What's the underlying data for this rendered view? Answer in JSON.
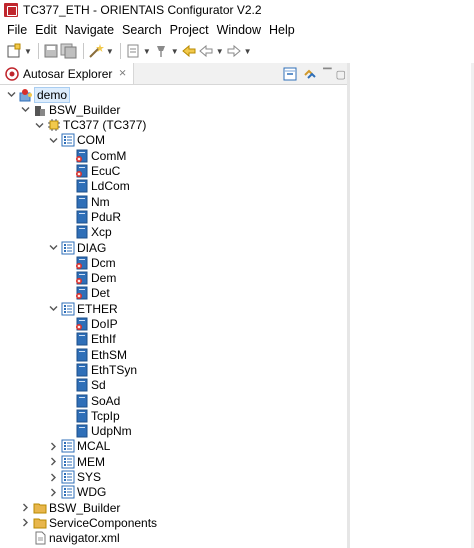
{
  "window": {
    "title": "TC377_ETH - ORIENTAIS Configurator V2.2"
  },
  "menu": [
    "File",
    "Edit",
    "Navigate",
    "Search",
    "Project",
    "Window",
    "Help"
  ],
  "explorer": {
    "tab_title": "Autosar Explorer",
    "tab_close": "⨯",
    "tree": [
      {
        "label": "demo",
        "level": 0,
        "expanded": true,
        "icon": "project-icon",
        "selected": true
      },
      {
        "label": "BSW_Builder",
        "level": 1,
        "expanded": true,
        "icon": "bsw-builder-icon"
      },
      {
        "label": "TC377 (TC377)",
        "level": 2,
        "expanded": true,
        "icon": "ecu-chip-icon"
      },
      {
        "label": "COM",
        "level": 3,
        "expanded": true,
        "icon": "module-group-icon"
      },
      {
        "label": "ComM",
        "level": 4,
        "icon": "module-icon-error"
      },
      {
        "label": "EcuC",
        "level": 4,
        "icon": "module-icon-error"
      },
      {
        "label": "LdCom",
        "level": 4,
        "icon": "module-icon"
      },
      {
        "label": "Nm",
        "level": 4,
        "icon": "module-icon"
      },
      {
        "label": "PduR",
        "level": 4,
        "icon": "module-icon"
      },
      {
        "label": "Xcp",
        "level": 4,
        "icon": "module-icon"
      },
      {
        "label": "DIAG",
        "level": 3,
        "expanded": true,
        "icon": "module-group-icon"
      },
      {
        "label": "Dcm",
        "level": 4,
        "icon": "module-icon-error"
      },
      {
        "label": "Dem",
        "level": 4,
        "icon": "module-icon-error"
      },
      {
        "label": "Det",
        "level": 4,
        "icon": "module-icon-error"
      },
      {
        "label": "ETHER",
        "level": 3,
        "expanded": true,
        "icon": "module-group-icon"
      },
      {
        "label": "DoIP",
        "level": 4,
        "icon": "module-icon-error"
      },
      {
        "label": "EthIf",
        "level": 4,
        "icon": "module-icon"
      },
      {
        "label": "EthSM",
        "level": 4,
        "icon": "module-icon"
      },
      {
        "label": "EthTSyn",
        "level": 4,
        "icon": "module-icon"
      },
      {
        "label": "Sd",
        "level": 4,
        "icon": "module-icon"
      },
      {
        "label": "SoAd",
        "level": 4,
        "icon": "module-icon"
      },
      {
        "label": "TcpIp",
        "level": 4,
        "icon": "module-icon"
      },
      {
        "label": "UdpNm",
        "level": 4,
        "icon": "module-icon"
      },
      {
        "label": "MCAL",
        "level": 3,
        "expanded": false,
        "icon": "module-group-icon"
      },
      {
        "label": "MEM",
        "level": 3,
        "expanded": false,
        "icon": "module-group-icon"
      },
      {
        "label": "SYS",
        "level": 3,
        "expanded": false,
        "icon": "module-group-icon"
      },
      {
        "label": "WDG",
        "level": 3,
        "expanded": false,
        "icon": "module-group-icon"
      },
      {
        "label": "BSW_Builder",
        "level": 1,
        "expanded": false,
        "icon": "folder-icon"
      },
      {
        "label": "ServiceComponents",
        "level": 1,
        "expanded": false,
        "icon": "folder-icon"
      },
      {
        "label": "navigator.xml",
        "level": 1,
        "icon": "xml-file-icon"
      }
    ]
  },
  "colors": {
    "accent": "#c0262d",
    "selection": "#dcecfc",
    "module_blue": "#2f6fb8",
    "error_red": "#d9302b",
    "folder": "#e8b64c"
  }
}
